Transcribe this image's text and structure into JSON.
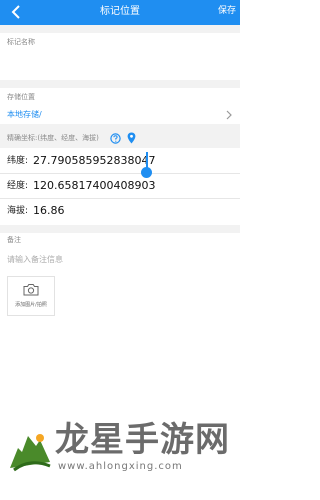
{
  "header": {
    "title": "标记位置",
    "save_label": "保存",
    "back_icon": "back-arrow-icon",
    "background_color": "#1f8ef1"
  },
  "name_field": {
    "label": "标记名称",
    "value": ""
  },
  "storage": {
    "label": "存储位置",
    "value": "本地存储/",
    "chevron_icon": "chevron-right-icon",
    "accent_color": "#1f8ef1"
  },
  "coordinates": {
    "label": "精确坐标:(纬度、经度、海拔)",
    "help_icon": "help-icon",
    "location_icon": "location-pin-icon",
    "latitude_label": "纬度:",
    "latitude_value": "27.790585952838047",
    "longitude_label": "经度:",
    "longitude_value": "120.65817400408903",
    "altitude_label": "海拔:",
    "altitude_value": "16.86"
  },
  "remark": {
    "label": "备注",
    "placeholder": "请输入备注信息"
  },
  "photo": {
    "icon": "camera-icon",
    "label": "添加图片/拍照"
  },
  "watermark": {
    "text": "龙星手游网",
    "url": "www.ahlongxing.com"
  }
}
